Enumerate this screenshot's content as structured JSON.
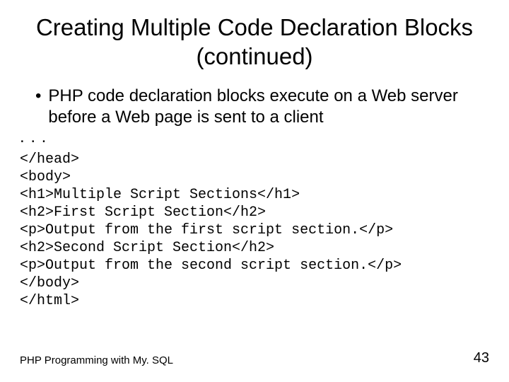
{
  "title": "Creating Multiple Code Declaration Blocks (continued)",
  "bullet": "PHP code declaration blocks execute on a Web server before a Web page is sent to a client",
  "ellipsis": ". . .",
  "code_lines": [
    "</head>",
    "<body>",
    "<h1>Multiple Script Sections</h1>",
    "<h2>First Script Section</h2>",
    "<p>Output from the first script section.</p>",
    "<h2>Second Script Section</h2>",
    "<p>Output from the second script section.</p>",
    "</body>",
    "</html>"
  ],
  "footer_left": "PHP Programming with My. SQL",
  "footer_right": "43"
}
